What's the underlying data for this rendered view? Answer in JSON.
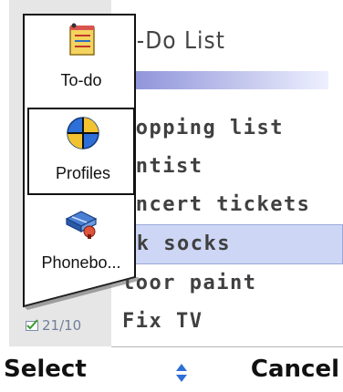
{
  "app": {
    "title": "o-Do List"
  },
  "todo_list": {
    "items": [
      {
        "text": "hopping list",
        "selected": false
      },
      {
        "text": "entist",
        "selected": false
      },
      {
        "text": "oncert tickets",
        "selected": false
      },
      {
        "text": "nk socks",
        "selected": true
      },
      {
        "text": "loor paint",
        "selected": false
      },
      {
        "text": "Fix TV",
        "selected": false
      }
    ]
  },
  "status": {
    "date": "21/10"
  },
  "switcher": {
    "items": [
      {
        "label": "To-do",
        "icon": "todo-notepad-icon",
        "active": false
      },
      {
        "label": "Profiles",
        "icon": "profiles-globe-icon",
        "active": true
      },
      {
        "label": "Phonebo...",
        "icon": "phonebook-icon",
        "active": false
      }
    ]
  },
  "softkeys": {
    "left": "Select",
    "right": "Cancel"
  },
  "colors": {
    "selection": "#cdd6f4",
    "title_gradient_start": "#8a8fd8",
    "strip": "#e6e6e6"
  }
}
